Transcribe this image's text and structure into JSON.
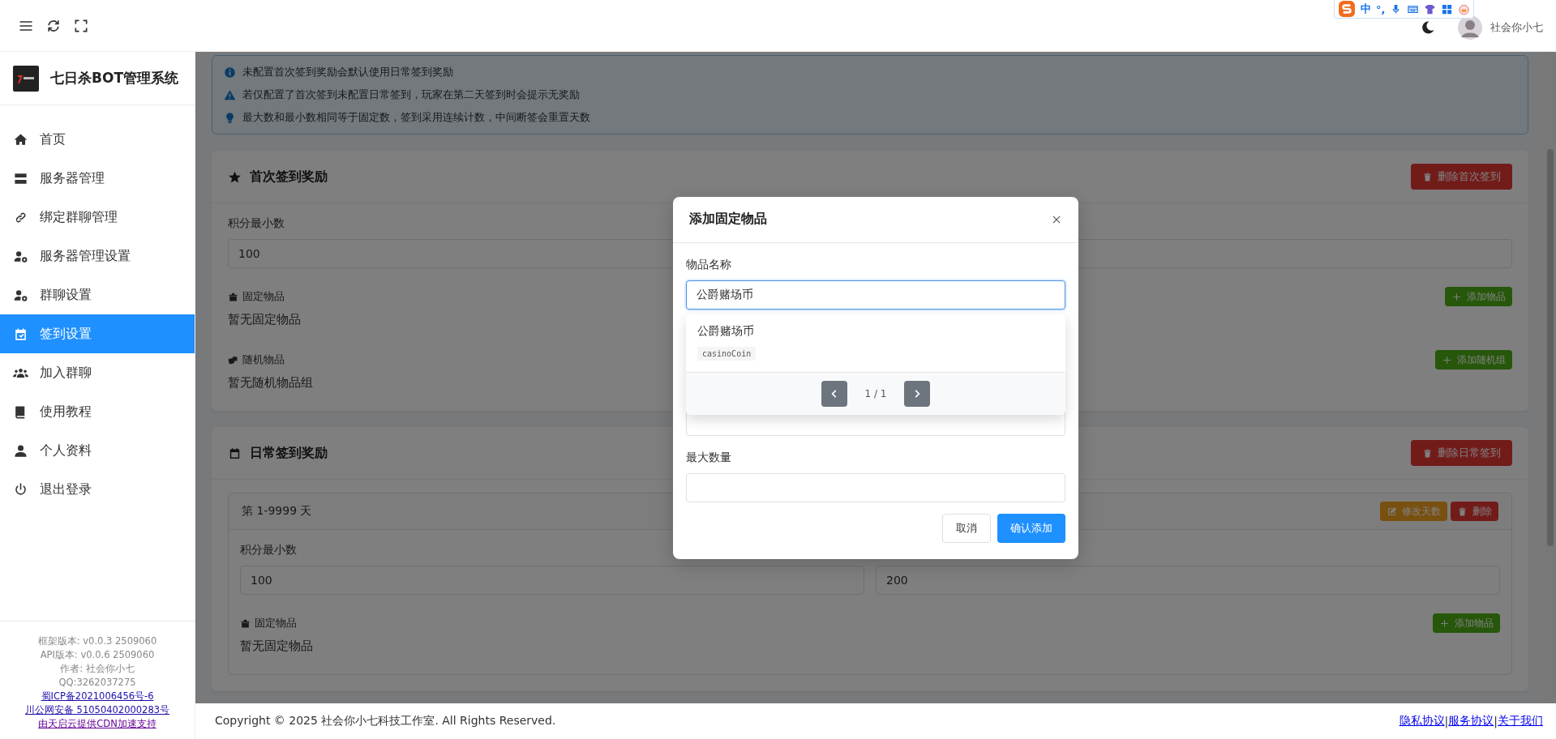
{
  "ime_bar": {
    "mode": "中",
    "punctuation": "°,"
  },
  "user": {
    "name": "社会你小七"
  },
  "sidebar": {
    "title": "七日杀BOT管理系统",
    "items": [
      {
        "label": "首页",
        "selected": false
      },
      {
        "label": "服务器管理",
        "selected": false
      },
      {
        "label": "绑定群聊管理",
        "selected": false
      },
      {
        "label": "服务器管理设置",
        "selected": false
      },
      {
        "label": "群聊设置",
        "selected": false
      },
      {
        "label": "签到设置",
        "selected": true
      },
      {
        "label": "加入群聊",
        "selected": false
      },
      {
        "label": "使用教程",
        "selected": false
      },
      {
        "label": "个人资料",
        "selected": false
      },
      {
        "label": "退出登录",
        "selected": false
      }
    ],
    "info_lines": [
      "框架版本: v0.0.3 2509060",
      "API版本: v0.0.6 2509060",
      "作者: 社会你小七",
      "QQ:3262037275"
    ],
    "links": [
      {
        "text": "蜀ICP备2021006456号-6",
        "visited": false
      },
      {
        "text": "川公网安备 51050402000283号",
        "visited": false
      },
      {
        "text": "由天启云提供CDN加速支持",
        "visited": true
      }
    ]
  },
  "notices": [
    {
      "kind": "info",
      "text": "未配置首次签到奖励会默认使用日常签到奖励"
    },
    {
      "kind": "warning",
      "text": "若仅配置了首次签到未配置日常签到，玩家在第二天签到时会提示无奖励"
    },
    {
      "kind": "tip",
      "text": "最大数和最小数相同等于固定数，签到采用连续计数，中间断签会重置天数"
    }
  ],
  "first_reward": {
    "title": "首次签到奖励",
    "delete_button": "删除首次签到",
    "min_label": "积分最小数",
    "min_value": "100",
    "fixed_label": "固定物品",
    "fixed_empty": "暂无固定物品",
    "add_item_button": "添加物品",
    "random_label": "随机物品",
    "random_empty": "暂无随机物品组",
    "add_random_button": "添加随机组"
  },
  "daily_reward": {
    "title": "日常签到奖励",
    "delete_button": "删除日常签到",
    "ranges": [
      {
        "title": "第 1-9999 天",
        "edit_button": "修改天数",
        "delete_button": "删除",
        "min_label": "积分最小数",
        "min_value": "100",
        "max_value": "200",
        "fixed_label": "固定物品",
        "fixed_empty": "暂无固定物品",
        "add_item_button": "添加物品"
      }
    ]
  },
  "modal": {
    "title": "添加固定物品",
    "name_label": "物品名称",
    "name_value": "公爵赌场币",
    "suggestions": [
      {
        "name": "公爵赌场币",
        "code": "casinoCoin"
      }
    ],
    "page": "1 / 1",
    "max_label": "最大数量",
    "cancel_button": "取消",
    "confirm_button": "确认添加"
  },
  "footer": {
    "copyright": "Copyright © 2025 社会你小七科技工作室. All Rights Reserved.",
    "separator": "|",
    "links": [
      "隐私协议",
      "服务协议",
      "关于我们"
    ]
  }
}
